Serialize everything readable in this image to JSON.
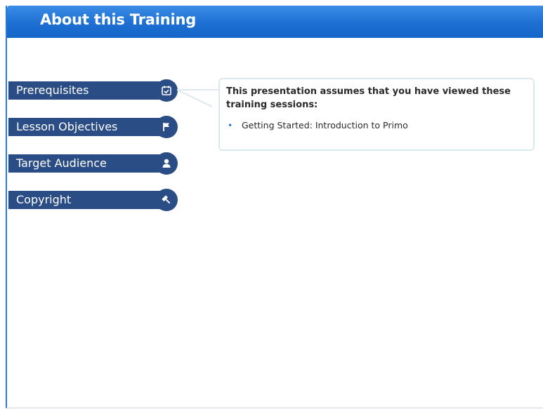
{
  "header": {
    "title": "About this Training"
  },
  "tabs": [
    {
      "label": "Prerequisites",
      "icon": "calendar-check-icon"
    },
    {
      "label": "Lesson Objectives",
      "icon": "flag-icon"
    },
    {
      "label": "Target Audience",
      "icon": "person-icon"
    },
    {
      "label": "Copyright",
      "icon": "gavel-icon"
    }
  ],
  "callout": {
    "heading": "This presentation assumes that you have viewed these training sessions:",
    "items": [
      "Getting Started: Introduction to Primo"
    ]
  },
  "colors": {
    "title_bar": "#1d6fd3",
    "tab_background": "#2b4d85",
    "callout_border": "#dbe9ee",
    "bullet": "#2b7bd6"
  }
}
